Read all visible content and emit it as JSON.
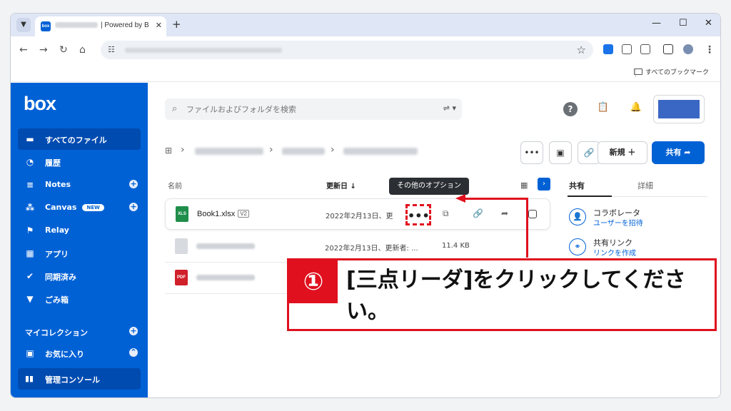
{
  "browser": {
    "tab_title": "| Powered by B",
    "bookmarks_all": "すべてのブックマーク"
  },
  "sidebar": {
    "logo": "box",
    "items": [
      {
        "label": "すべてのファイル",
        "icon": "folder-icon"
      },
      {
        "label": "履歴",
        "icon": "clock-icon"
      },
      {
        "label": "Notes",
        "icon": "notes-icon"
      },
      {
        "label": "Canvas",
        "icon": "canvas-icon",
        "badge": "NEW"
      },
      {
        "label": "Relay",
        "icon": "relay-icon"
      },
      {
        "label": "アプリ",
        "icon": "apps-grid-icon"
      },
      {
        "label": "同期済み",
        "icon": "check-circle-icon"
      },
      {
        "label": "ごみ箱",
        "icon": "trash-icon"
      }
    ],
    "collections_label": "マイコレクション",
    "favorites_label": "お気に入り",
    "admin_label": "管理コンソール"
  },
  "header": {
    "search_placeholder": "ファイルおよびフォルダを検索"
  },
  "toolbar": {
    "new_label": "新規",
    "share_label": "共有"
  },
  "file_list": {
    "col_name": "名前",
    "col_updated": "更新日",
    "tooltip": "その他のオプション",
    "rows": [
      {
        "name": "Book1.xlsx",
        "version": "V2",
        "updated": "2022年2月13日、更",
        "size": "",
        "type": "excel"
      },
      {
        "name": "",
        "version": "",
        "updated": "2022年2月13日、更新者: ...",
        "size": "11.4 KB",
        "type": "file"
      },
      {
        "name": "",
        "version": "",
        "updated": "",
        "size": "",
        "type": "pdf"
      }
    ]
  },
  "right_panel": {
    "tab_share": "共有",
    "tab_details": "詳細",
    "items": [
      {
        "title": "コラボレータ",
        "link": "ユーザーを招待"
      },
      {
        "title": "共有リンク",
        "link": "リンクを作成"
      }
    ]
  },
  "annotation": {
    "number": "①",
    "text": "[三点リーダ]をクリックしてください。"
  },
  "colors": {
    "brand": "#0061d5",
    "annotation": "#e0101e"
  }
}
